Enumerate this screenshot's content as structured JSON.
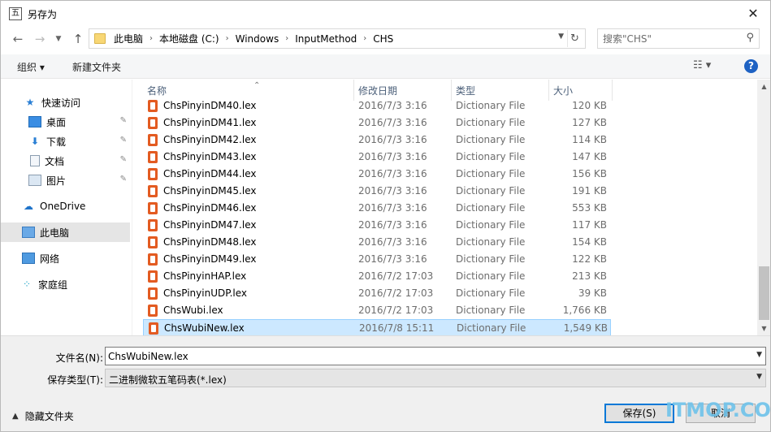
{
  "window": {
    "title": "另存为",
    "app_icon_glyph": "五",
    "close_glyph": "✕"
  },
  "navigation": {
    "back_glyph": "←",
    "forward_glyph": "→",
    "dropdown_glyph": "⌄",
    "up_glyph": "↑",
    "breadcrumbs": [
      "此电脑",
      "本地磁盘 (C:)",
      "Windows",
      "InputMethod",
      "CHS"
    ],
    "search_placeholder": "搜索\"CHS\""
  },
  "toolbar": {
    "organize_label": "组织 ▾",
    "new_folder_label": "新建文件夹"
  },
  "sidebar": {
    "items": [
      {
        "label": "快速访问"
      },
      {
        "label": "桌面"
      },
      {
        "label": "下载"
      },
      {
        "label": "文档"
      },
      {
        "label": "图片"
      },
      {
        "label": "OneDrive"
      },
      {
        "label": "此电脑"
      },
      {
        "label": "网络"
      },
      {
        "label": "家庭组"
      }
    ]
  },
  "columns": {
    "name": "名称",
    "date": "修改日期",
    "type": "类型",
    "size": "大小"
  },
  "files": [
    {
      "name": "ChsPinyinDM40.lex",
      "date": "2016/7/3 3:16",
      "type": "Dictionary File",
      "size": "120 KB"
    },
    {
      "name": "ChsPinyinDM41.lex",
      "date": "2016/7/3 3:16",
      "type": "Dictionary File",
      "size": "127 KB"
    },
    {
      "name": "ChsPinyinDM42.lex",
      "date": "2016/7/3 3:16",
      "type": "Dictionary File",
      "size": "114 KB"
    },
    {
      "name": "ChsPinyinDM43.lex",
      "date": "2016/7/3 3:16",
      "type": "Dictionary File",
      "size": "147 KB"
    },
    {
      "name": "ChsPinyinDM44.lex",
      "date": "2016/7/3 3:16",
      "type": "Dictionary File",
      "size": "156 KB"
    },
    {
      "name": "ChsPinyinDM45.lex",
      "date": "2016/7/3 3:16",
      "type": "Dictionary File",
      "size": "191 KB"
    },
    {
      "name": "ChsPinyinDM46.lex",
      "date": "2016/7/3 3:16",
      "type": "Dictionary File",
      "size": "553 KB"
    },
    {
      "name": "ChsPinyinDM47.lex",
      "date": "2016/7/3 3:16",
      "type": "Dictionary File",
      "size": "117 KB"
    },
    {
      "name": "ChsPinyinDM48.lex",
      "date": "2016/7/3 3:16",
      "type": "Dictionary File",
      "size": "154 KB"
    },
    {
      "name": "ChsPinyinDM49.lex",
      "date": "2016/7/3 3:16",
      "type": "Dictionary File",
      "size": "122 KB"
    },
    {
      "name": "ChsPinyinHAP.lex",
      "date": "2016/7/2 17:03",
      "type": "Dictionary File",
      "size": "213 KB"
    },
    {
      "name": "ChsPinyinUDP.lex",
      "date": "2016/7/2 17:03",
      "type": "Dictionary File",
      "size": "39 KB"
    },
    {
      "name": "ChsWubi.lex",
      "date": "2016/7/2 17:03",
      "type": "Dictionary File",
      "size": "1,766 KB"
    },
    {
      "name": "ChsWubiNew.lex",
      "date": "2016/7/8 15:11",
      "type": "Dictionary File",
      "size": "1,549 KB"
    }
  ],
  "form": {
    "filename_label": "文件名(N):",
    "filename_value": "ChsWubiNew.lex",
    "filetype_label": "保存类型(T):",
    "filetype_value": "二进制微软五笔码表(*.lex)",
    "hide_folders_label": "隐藏文件夹",
    "save_label": "保存(S)",
    "cancel_label": "取消"
  },
  "watermark": "ITMOP.COM"
}
